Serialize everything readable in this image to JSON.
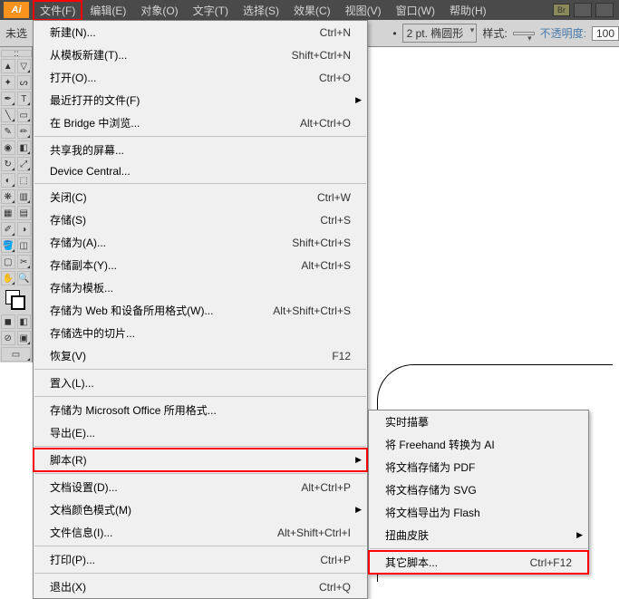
{
  "app": {
    "logo": "Ai"
  },
  "menubar": {
    "items": [
      {
        "label": "文件(F)",
        "hl": true
      },
      {
        "label": "编辑(E)"
      },
      {
        "label": "对象(O)"
      },
      {
        "label": "文字(T)"
      },
      {
        "label": "选择(S)"
      },
      {
        "label": "效果(C)"
      },
      {
        "label": "视图(V)"
      },
      {
        "label": "窗口(W)"
      },
      {
        "label": "帮助(H)"
      }
    ],
    "br": "Br"
  },
  "toolbar": {
    "left_text": "未选",
    "stroke": "2 pt. 椭圆形",
    "style_label": "样式:",
    "opacity_label": "不透明度:",
    "opacity_value": "100"
  },
  "file_menu": [
    {
      "label": "新建(N)...",
      "key": "Ctrl+N"
    },
    {
      "label": "从模板新建(T)...",
      "key": "Shift+Ctrl+N"
    },
    {
      "label": "打开(O)...",
      "key": "Ctrl+O"
    },
    {
      "label": "最近打开的文件(F)",
      "sub": true
    },
    {
      "label": "在 Bridge 中浏览...",
      "key": "Alt+Ctrl+O"
    },
    {
      "sep": true
    },
    {
      "label": "共享我的屏幕..."
    },
    {
      "label": "Device Central..."
    },
    {
      "sep": true
    },
    {
      "label": "关闭(C)",
      "key": "Ctrl+W"
    },
    {
      "label": "存储(S)",
      "key": "Ctrl+S"
    },
    {
      "label": "存储为(A)...",
      "key": "Shift+Ctrl+S"
    },
    {
      "label": "存储副本(Y)...",
      "key": "Alt+Ctrl+S"
    },
    {
      "label": "存储为模板..."
    },
    {
      "label": "存储为 Web 和设备所用格式(W)...",
      "key": "Alt+Shift+Ctrl+S"
    },
    {
      "label": "存储选中的切片..."
    },
    {
      "label": "恢复(V)",
      "key": "F12"
    },
    {
      "sep": true
    },
    {
      "label": "置入(L)..."
    },
    {
      "sep": true
    },
    {
      "label": "存储为 Microsoft Office 所用格式..."
    },
    {
      "label": "导出(E)..."
    },
    {
      "sep": true
    },
    {
      "label": "脚本(R)",
      "sub": true,
      "hl": true
    },
    {
      "sep": true
    },
    {
      "label": "文档设置(D)...",
      "key": "Alt+Ctrl+P"
    },
    {
      "label": "文档颜色模式(M)",
      "sub": true
    },
    {
      "label": "文件信息(I)...",
      "key": "Alt+Shift+Ctrl+I"
    },
    {
      "sep": true
    },
    {
      "label": "打印(P)...",
      "key": "Ctrl+P"
    },
    {
      "sep": true
    },
    {
      "label": "退出(X)",
      "key": "Ctrl+Q"
    }
  ],
  "script_submenu": [
    {
      "label": "实时描摹"
    },
    {
      "label": "将 Freehand 转换为 AI"
    },
    {
      "label": "将文档存储为 PDF"
    },
    {
      "label": "将文档存储为 SVG"
    },
    {
      "label": "将文档导出为 Flash"
    },
    {
      "label": "扭曲皮肤",
      "sub": true
    },
    {
      "sep": true
    },
    {
      "label": "其它脚本...",
      "key": "Ctrl+F12",
      "hl": true
    }
  ]
}
